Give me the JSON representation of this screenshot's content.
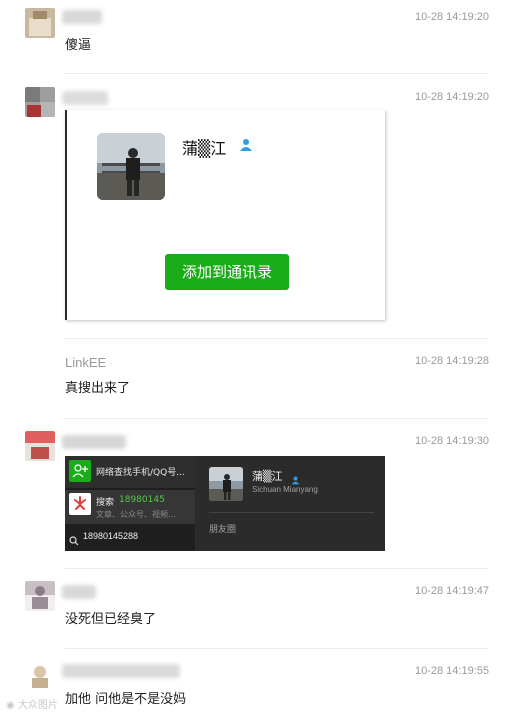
{
  "comments": [
    {
      "time": "10-28 14:19:20",
      "text": "傻逼"
    },
    {
      "time": "10-28 14:19:20"
    },
    {
      "name": "LinkEE",
      "time": "10-28 14:19:28",
      "text": "真搜出来了"
    },
    {
      "time": "10-28 14:19:30"
    },
    {
      "time": "10-28 14:19:47",
      "text": "没死但已经臭了"
    },
    {
      "time": "10-28 14:19:55",
      "text": "加他 问他是不是没妈"
    }
  ],
  "contact_card": {
    "name": "蒲▒江",
    "add_button": "添加到通讯录"
  },
  "search_shot": {
    "row1_text": "网络查找手机/QQ号...",
    "row2_label": "搜索",
    "row2_number": "18980145",
    "row2_sub": "文章、公众号、视频...",
    "bottom_text": "18980145288",
    "right_name": "蒲▒江",
    "right_location": "Sichuan Mianyang",
    "right_moments": "朋友圈"
  },
  "watermark": "大众图片",
  "colors": {
    "accent_green": "#1aad19",
    "time_gray": "#9a9a9a"
  }
}
